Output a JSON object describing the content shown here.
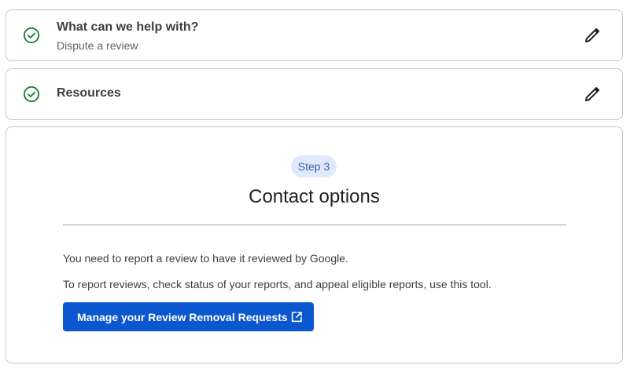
{
  "accordion": [
    {
      "title": "What can we help with?",
      "subtitle": "Dispute a review",
      "icon": "check-circle-icon",
      "edit_icon": "pencil-icon"
    },
    {
      "title": "Resources",
      "icon": "check-circle-icon",
      "edit_icon": "pencil-icon"
    }
  ],
  "step": {
    "chip_label": "Step 3",
    "title": "Contact options",
    "paragraphs": [
      "You need to report a review to have it reviewed by Google.",
      "To report reviews, check status of your reports, and appeal eligible reports, use this tool."
    ],
    "button_label": "Manage your Review Removal Requests",
    "button_icon": "open-in-new-icon"
  },
  "colors": {
    "success_green": "#188038",
    "primary_blue": "#0b57d0",
    "chip_background": "#dfe9fb",
    "chip_text": "#3c63a6"
  }
}
